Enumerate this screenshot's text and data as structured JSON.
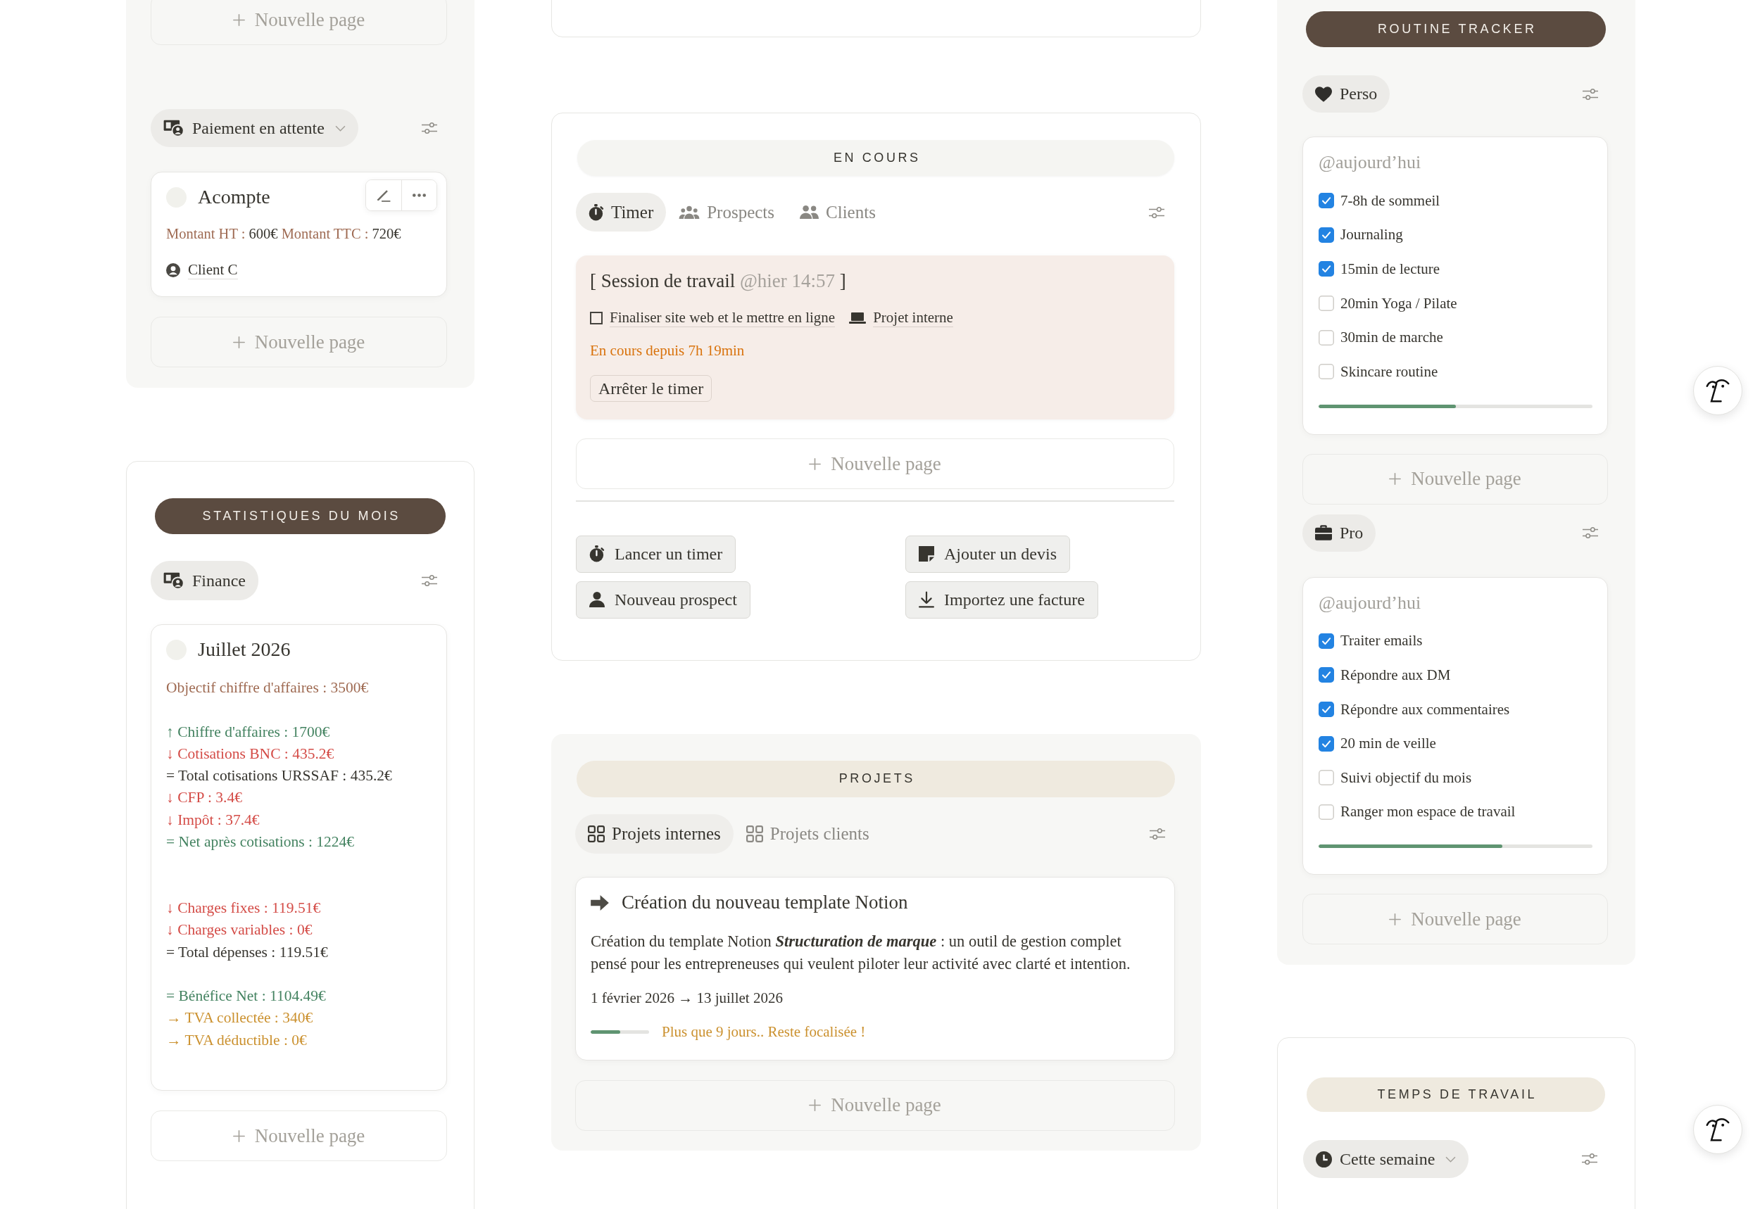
{
  "payments": {
    "add_above": "Nouvelle page",
    "view": "Paiement en attente",
    "cards": [
      {
        "title": "Acompte",
        "hovered": true,
        "amounts": [
          {
            "label": "Montant HT :",
            "value": "600€"
          },
          {
            "label": "Montant TTC :",
            "value": "720€"
          }
        ],
        "client": "Client C"
      }
    ],
    "add_below": "Nouvelle page"
  },
  "monthly_stats": {
    "heading": {
      "text": "STATISTIQUES DU MOIS",
      "kind": "dark"
    },
    "view": "Finance",
    "cards": [
      {
        "title": "Juillet 2026",
        "lines": [
          {
            "kind": "text",
            "text": "Objectif chiffre d'affaires : 3500€",
            "color": "#9f6b53"
          },
          {
            "kind": "blank"
          },
          {
            "kind": "text",
            "text": "↑ Chiffre d'affaires : 1700€",
            "color": "#448361"
          },
          {
            "kind": "text",
            "text": "↓ Cotisations BNC : 435.2€",
            "color": "#d44c47"
          },
          {
            "kind": "text",
            "text": "= Total cotisations URSSAF : 435.2€",
            "color": "#37352f"
          },
          {
            "kind": "text",
            "text": "↓ CFP : 3.4€",
            "color": "#d44c47"
          },
          {
            "kind": "text",
            "text": "↓ Impôt : 37.4€",
            "color": "#d44c47"
          },
          {
            "kind": "text",
            "text": "= Net après cotisations : 1224€",
            "color": "#448361"
          },
          {
            "kind": "blank"
          },
          {
            "kind": "blank"
          },
          {
            "kind": "text",
            "text": "↓ Charges fixes : 119.51€",
            "color": "#d44c47"
          },
          {
            "kind": "text",
            "text": "↓ Charges variables : 0€",
            "color": "#d44c47"
          },
          {
            "kind": "text",
            "text": "= Total dépenses : 119.51€",
            "color": "#37352f"
          },
          {
            "kind": "blank"
          },
          {
            "kind": "text",
            "text": "= Bénéfice Net : 1104.49€",
            "color": "#448361"
          },
          {
            "kind": "text",
            "text": "→ TVA collectée : 340€",
            "color": "#cb912f"
          },
          {
            "kind": "text",
            "text": "→ TVA déductible : 0€",
            "color": "#cb912f"
          }
        ]
      }
    ],
    "add_below": "Nouvelle page"
  },
  "in_progress": {
    "heading": {
      "text": "EN COURS",
      "kind": "light"
    },
    "tabs": [
      {
        "label": "Timer",
        "selected": true
      },
      {
        "label": "Prospects",
        "selected": false
      },
      {
        "label": "Clients",
        "selected": false
      }
    ],
    "session": {
      "bracket_open": "[",
      "title": "Session de travail",
      "date": "@hier 14:57",
      "bracket_close": "]",
      "task": "Finaliser site web et le mettre en ligne",
      "project": "Projet interne",
      "elapsed": "En cours depuis 7h 19min",
      "stop_button": "Arrêter le timer"
    },
    "add_below": "Nouvelle page",
    "actions": [
      "Lancer un timer",
      "Ajouter un devis",
      "Nouveau prospect",
      "Importez une facture"
    ]
  },
  "projects": {
    "heading": {
      "text": "PROJETS",
      "kind": "beige"
    },
    "tabs": [
      {
        "label": "Projets internes",
        "selected": true
      },
      {
        "label": "Projets clients",
        "selected": false
      }
    ],
    "cards": [
      {
        "title": "Création du nouveau template Notion",
        "description": "Création du template Notion **Structuration de marque** : un outil de gestion complet pensé pour les entrepreneuses qui veulent piloter leur activité avec clarté et intention.",
        "dates": "1 février 2026 → 13 juillet 2026",
        "level": 0.5,
        "note": "Plus que 9 jours.. Reste focalisée !"
      }
    ],
    "add_below": "Nouvelle page"
  },
  "routine": {
    "heading": {
      "text": "ROUTINE TRACKER",
      "kind": "dark"
    },
    "groups": [
      {
        "view": "Perso",
        "date": "@aujourd’hui",
        "items": [
          {
            "label": "7-8h de sommeil",
            "checked": true
          },
          {
            "label": "Journaling",
            "checked": true
          },
          {
            "label": "15min de lecture",
            "checked": true
          },
          {
            "label": "20min Yoga / Pilate",
            "checked": false
          },
          {
            "label": "30min de marche",
            "checked": false
          },
          {
            "label": "Skincare routine",
            "checked": false
          }
        ],
        "level": 0.5,
        "add_below": "Nouvelle page"
      },
      {
        "view": "Pro",
        "date": "@aujourd’hui",
        "items": [
          {
            "label": "Traiter emails",
            "checked": true
          },
          {
            "label": "Répondre aux DM",
            "checked": true
          },
          {
            "label": "Répondre aux commentaires",
            "checked": true
          },
          {
            "label": "20 min de veille",
            "checked": true
          },
          {
            "label": "Suivi objectif du mois",
            "checked": false
          },
          {
            "label": "Ranger mon espace de travail",
            "checked": false
          }
        ],
        "level": 0.67,
        "add_below": "Nouvelle page"
      }
    ]
  },
  "work_time": {
    "heading": {
      "text": "TEMPS DE TRAVAIL",
      "kind": "beige"
    },
    "view": "Cette semaine"
  }
}
